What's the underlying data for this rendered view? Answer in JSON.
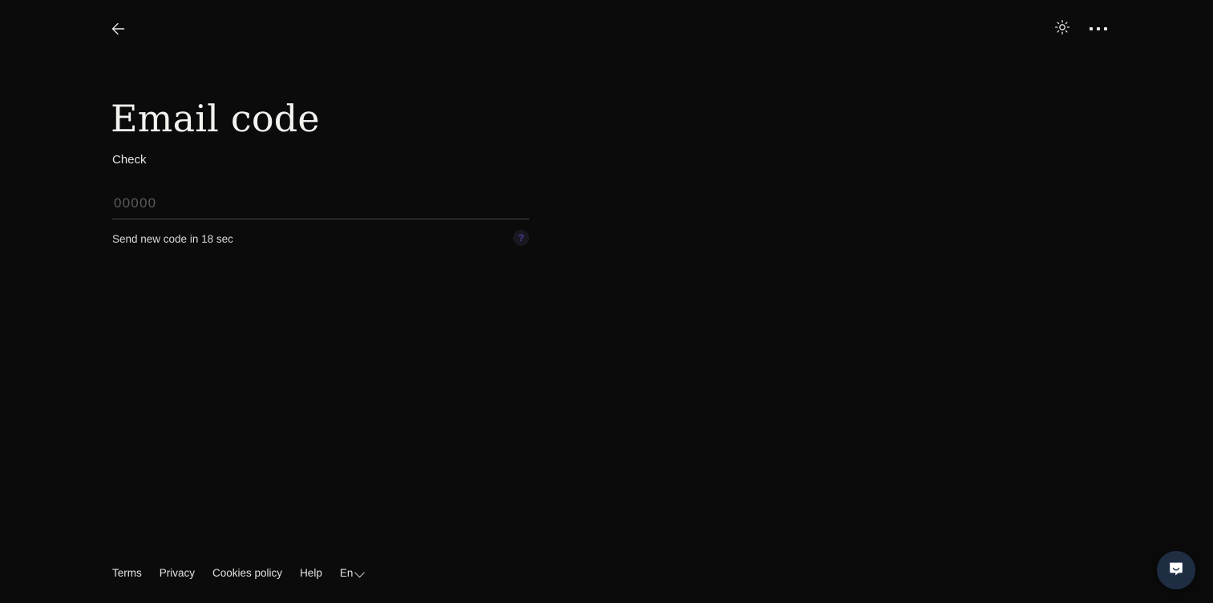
{
  "header": {
    "back_icon": "arrow-left-icon",
    "theme_icon": "sun-icon",
    "menu_icon": "more-horizontal-icon"
  },
  "main": {
    "title": "Email code",
    "subtitle": "Check",
    "code_input": {
      "value": "",
      "placeholder": "00000"
    },
    "resend_text": "Send new code in 18 sec",
    "help_badge": "?"
  },
  "footer": {
    "links": [
      {
        "label": "Terms"
      },
      {
        "label": "Privacy"
      },
      {
        "label": "Cookies policy"
      },
      {
        "label": "Help"
      }
    ],
    "language": "En"
  },
  "chat": {
    "icon": "intercom-messenger-icon"
  },
  "colors": {
    "background": "#0b0b0b",
    "text_primary": "#f4f2ef",
    "text_secondary": "#dcdad7",
    "placeholder": "#5b5b5b",
    "underline": "#4e4e4e",
    "help_accent": "#4c3c95",
    "chat_bubble": "#1f2d43"
  }
}
